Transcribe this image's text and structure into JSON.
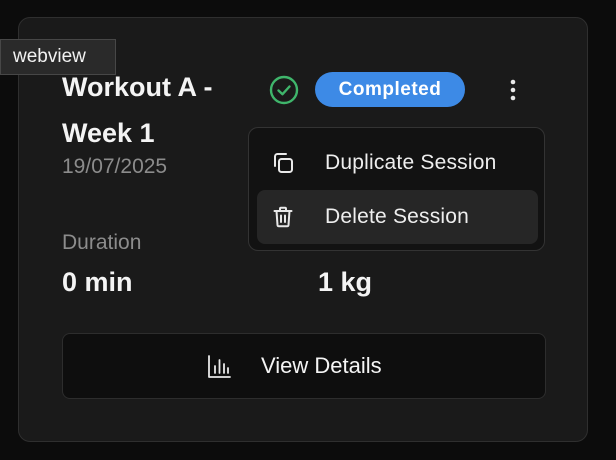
{
  "webview_tag": "webview",
  "session": {
    "title": "Workout A - Week 1",
    "date": "19/07/2025",
    "status": "Completed",
    "stats": [
      {
        "label": "Duration",
        "value": "0 min"
      },
      {
        "label": "",
        "value": "1 kg"
      }
    ]
  },
  "menu": {
    "items": [
      {
        "label": "Duplicate Session",
        "icon": "copy-icon"
      },
      {
        "label": "Delete Session",
        "icon": "trash-icon"
      }
    ]
  },
  "actions": {
    "view_details_label": "View Details",
    "view_details_icon": "bar-chart-icon"
  },
  "colors": {
    "accent": "#3d8ae6",
    "success": "#3fb56b",
    "card_bg": "#1a1a1a",
    "page_bg": "#0c0c0c"
  }
}
